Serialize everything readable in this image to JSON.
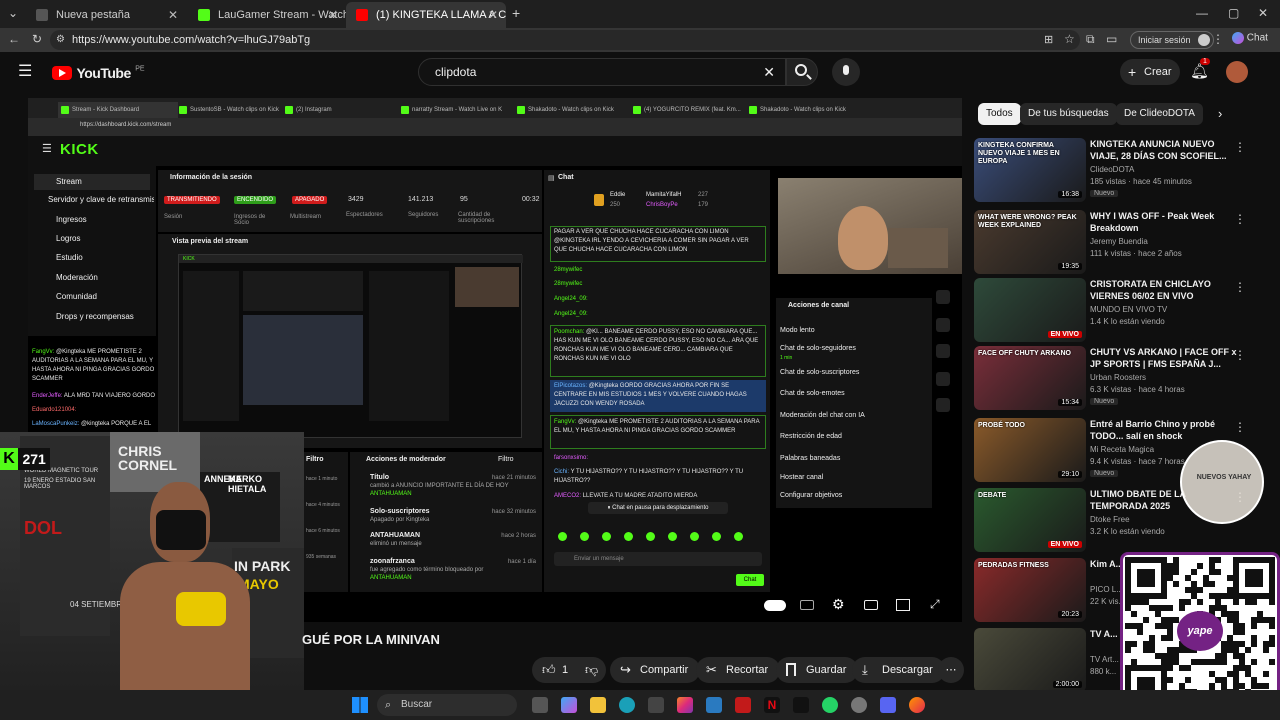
{
  "browser": {
    "tabs": [
      {
        "title": "Nueva pestaña"
      },
      {
        "title": "LauGamer Stream - Watch Live on"
      },
      {
        "title": "(1) KINGTEKA LLAMA A CIRIL"
      }
    ],
    "url": "https://www.youtube.com/watch?v=lhuGJ79abTg",
    "signin_label": "Iniciar sesión",
    "chat_label": "Chat"
  },
  "youtube": {
    "logo_text": "YouTube",
    "logo_region": "PE",
    "search_value": "clipdota",
    "create_label": "Crear",
    "notification_count": "1"
  },
  "inner_browser": {
    "tabs": [
      "Stream - Kick Dashboard",
      "SustentoSB - Watch clips on Kick",
      "(2) Instagram",
      "narratty Stream - Watch Live on K",
      "Shakadoto - Watch clips on Kick",
      "(4) YOGURCITO REMIX (feat. Km...",
      "Shakadoto - Watch clips on Kick"
    ],
    "url": "https://dashboard.kick.com/stream"
  },
  "kick": {
    "logo": "KICK",
    "sidebar": [
      "Stream",
      "Servidor y clave de retransmisión",
      "Ingresos",
      "Logros",
      "Estudio",
      "Moderación",
      "Comunidad",
      "Drops y recompensas"
    ],
    "session_title": "Información de la sesión",
    "badges": [
      "TRANSMITIENDO",
      "ENCENDIDO",
      "APAGADO"
    ],
    "stats": [
      {
        "value": "3429",
        "label": "Espectadores"
      },
      {
        "value": "141.213",
        "label": "Seguidores"
      },
      {
        "value": "95",
        "label": "Cantidad de suscripciones"
      },
      {
        "value": "00:32",
        "label": "Tiempo"
      }
    ],
    "stat_labels_left": [
      "Sesión",
      "Ingresos de Socio",
      "Multistream"
    ],
    "preview_title": "Vista previa del stream",
    "left_chat": [
      {
        "user": "FangVv:",
        "text": "@Kingteka ME PROMETISTE 2 AUDITORIAS A LA SEMANA PARA EL MU, Y HASTA AHORA NI PINGA GRACIAS GORDO SCAMMER"
      },
      {
        "user": "EnderJeffe:",
        "text": "ALA MRD TAN VIAJERO GORDO"
      },
      {
        "user": "Eduardo121004:",
        "text": ""
      },
      {
        "user": "LaMoscaPunkeiz:",
        "text": "@kingteka PORQUE A EL"
      }
    ],
    "viewer_count": "271",
    "chat_title": "Chat",
    "chat_pinned_users": [
      "Eddie",
      "MamitaYifalH",
      "ChrisBoyPe"
    ],
    "chat_pinned_counts": [
      "227",
      "250",
      "179"
    ],
    "chat_lines": [
      {
        "user": "",
        "text": "PAGAR A VER QUE CHUCHA HACE CUCARACHA CON LIMON @KINGTEKA IRL YENDO A CEVICHERIA A COMER SIN PAGAR A VER QUE CHUCHA HACE CUCARACHA CON LIMON"
      },
      {
        "user": "28mywifec",
        "text": ""
      },
      {
        "user": "28mywifec",
        "text": ""
      },
      {
        "user": "Angel24_09:",
        "text": ""
      },
      {
        "user": "Angel24_09:",
        "text": ""
      },
      {
        "user": "Poomchan:",
        "text": "@KI... BANEAME CERDO PUSSY, ESO NO CAMBIARA QUE... HAS KUN ME VI OLO BANEAME CERDO PUSSY, ESO NO CA... ARA QUE RONCHAS KUN ME VI OLO BANEAME CERD... CAMBIARA QUE RONCHAS KUN ME VI OLO"
      },
      {
        "user": "ElPicotazos:",
        "text": "@Kingteka GORDO GRACIAS AHORA POR FIN SE CENTRARE EN MIS ESTUDIOS 1 MES Y VOLVERE CUANDO HAGAS JACUZZI CON WENDY ROSADA"
      },
      {
        "user": "FangVv:",
        "text": "@Kingteka ME PROMETISTE 2 AUDITORIAS A LA SEMANA PARA EL MU, Y HASTA AHORA NI PINGA GRACIAS GORDO SCAMMER"
      },
      {
        "user": "farsonxsimo:",
        "text": ""
      },
      {
        "user": "Cichi:",
        "text": "Y TU HIJASTRO?? Y TU HIJASTRO?? Y TU HIJASTRO?? Y TU HIJASTRO??"
      },
      {
        "user": "AMECO2:",
        "text": "LLEVATE A TU MADRE ATADITO MIERDA"
      }
    ],
    "chat_paused": "Chat en pausa para desplazamiento",
    "chat_input_placeholder": "Enviar un mensaje",
    "chat_send": "Chat",
    "actions_title": "Acciones de canal",
    "actions": [
      "Modo lento",
      "Chat de solo-seguidores",
      "Chat de solo-suscriptores",
      "Chat de solo-emotes",
      "Moderación del chat con IA",
      "Restricción de edad",
      "Palabras baneadas",
      "Hostear canal",
      "Configurar objetivos"
    ],
    "actions_sub": "1 min",
    "mod_title": "Acciones de moderador",
    "filter_label": "Filtro",
    "mod_actions": [
      {
        "title": "Título",
        "desc": "cambió a ANUNCIO IMPORTANTE EL DÍA DE HOY",
        "by": "ANTAHUAMAN",
        "time": "hace 21 minutos"
      },
      {
        "title": "Solo-suscriptores",
        "desc": "Apagado por Kingteka",
        "by": "",
        "time": "hace 32 minutos"
      },
      {
        "title": "ANTAHUAMAN",
        "desc": "eliminó un mensaje",
        "by": "",
        "time": "hace 2 horas"
      },
      {
        "title": "zoonafrzanca",
        "desc": "fue agregado como término bloqueado por",
        "by": "ANTAHUAMAN",
        "time": "hace 1 día"
      }
    ],
    "filter_times": [
      "hace 1 minuto",
      "hace 4 minutos",
      "hace 6 minutos",
      "935 semanas"
    ]
  },
  "video": {
    "title": "GUÉ POR LA MINIVAN",
    "like_count": "1",
    "share_label": "Compartir",
    "clip_label": "Recortar",
    "save_label": "Guardar",
    "download_label": "Descargar"
  },
  "chips": [
    "Todos",
    "De tus búsquedas",
    "De ClideoDOTA"
  ],
  "recommendations": [
    {
      "title": "KINGTEKA ANUNCIA NUEVO VIAJE, 28 DÍAS CON SCOFIEL...",
      "channel": "ClideoDOTA",
      "meta": "185 vistas · hace 45 minutos",
      "badge": "Nuevo",
      "duration": "16:38",
      "live": "",
      "thumb_color": "#3a4d7a"
    },
    {
      "title": "WHY I WAS OFF - Peak Week Breakdown",
      "channel": "Jeremy Buendia",
      "meta": "111 k vistas · hace 2 años",
      "badge": "",
      "duration": "19:35",
      "live": "",
      "thumb_color": "#4a3a2e"
    },
    {
      "title": "CRISTORATA EN CHICLAYO VIERNES 06/02 EN VIVO",
      "channel": "MUNDO EN VIVO TV",
      "meta": "1.4 K lo están viendo",
      "badge": "",
      "duration": "",
      "live": "EN VIVO",
      "thumb_color": "#2e4a3a"
    },
    {
      "title": "CHUTY VS ARKANO | FACE OFF x JP SPORTS | FMS ESPAÑA J...",
      "channel": "Urban Roosters",
      "meta": "6.3 K vistas · hace 4 horas",
      "badge": "Nuevo",
      "duration": "15:34",
      "live": "",
      "thumb_color": "#7a2e3a"
    },
    {
      "title": "Entré al Barrio Chino y probé TODO... salí en shock",
      "channel": "Mi Receta Magica",
      "meta": "9.4 K vistas · hace 7 horas",
      "badge": "Nuevo",
      "duration": "29:10",
      "live": "",
      "thumb_color": "#8a5a2a"
    },
    {
      "title": "ULTIMO DBATE DE LA TEMPORADA 2025",
      "channel": "Dtoke Free",
      "meta": "3.2 K lo están viendo",
      "badge": "",
      "duration": "",
      "live": "EN VIVO",
      "thumb_color": "#2a5a2e"
    },
    {
      "title": "Kim A... 500 M...",
      "channel": "PICO L...",
      "meta": "22 K vis...",
      "badge": "",
      "duration": "20:23",
      "live": "",
      "thumb_color": "#8a2a2a"
    },
    {
      "title": "TV A... Paint...",
      "channel": "TV Art...",
      "meta": "880 k...",
      "badge": "",
      "duration": "2:00:00",
      "live": "",
      "thumb_color": "#4a4a3a"
    }
  ],
  "recommendation_thumb_texts": [
    "KINGTEKA CONFIRMA NUEVO VIAJE 1 MES EN EUROPA",
    "WHAT WERE WRONG? PEAK WEEK EXPLAINED",
    "",
    "FACE OFF CHUTY ARKANO",
    "PROBÉ TODO",
    "DEBATE",
    "PEDRADAS FITNESS",
    ""
  ],
  "taskbar": {
    "search_label": "Buscar"
  },
  "overlay": {
    "stamp_text": "NUEVOS YAHAY",
    "qr_brand": "yape",
    "poster_texts": [
      "CHRIS CORNEL",
      "ANNEKE",
      "MARKO HIETALA",
      "DOL",
      "IN PARK",
      "MAYO",
      "04 SETIEMBRE",
      "WORLD MAGNETIC TOUR",
      "19 ENERO ESTADIO SAN MARCOS"
    ]
  },
  "colors": {
    "kick_green": "#53fc18",
    "youtube_red": "#ff0000",
    "yape_purple": "#742284"
  }
}
